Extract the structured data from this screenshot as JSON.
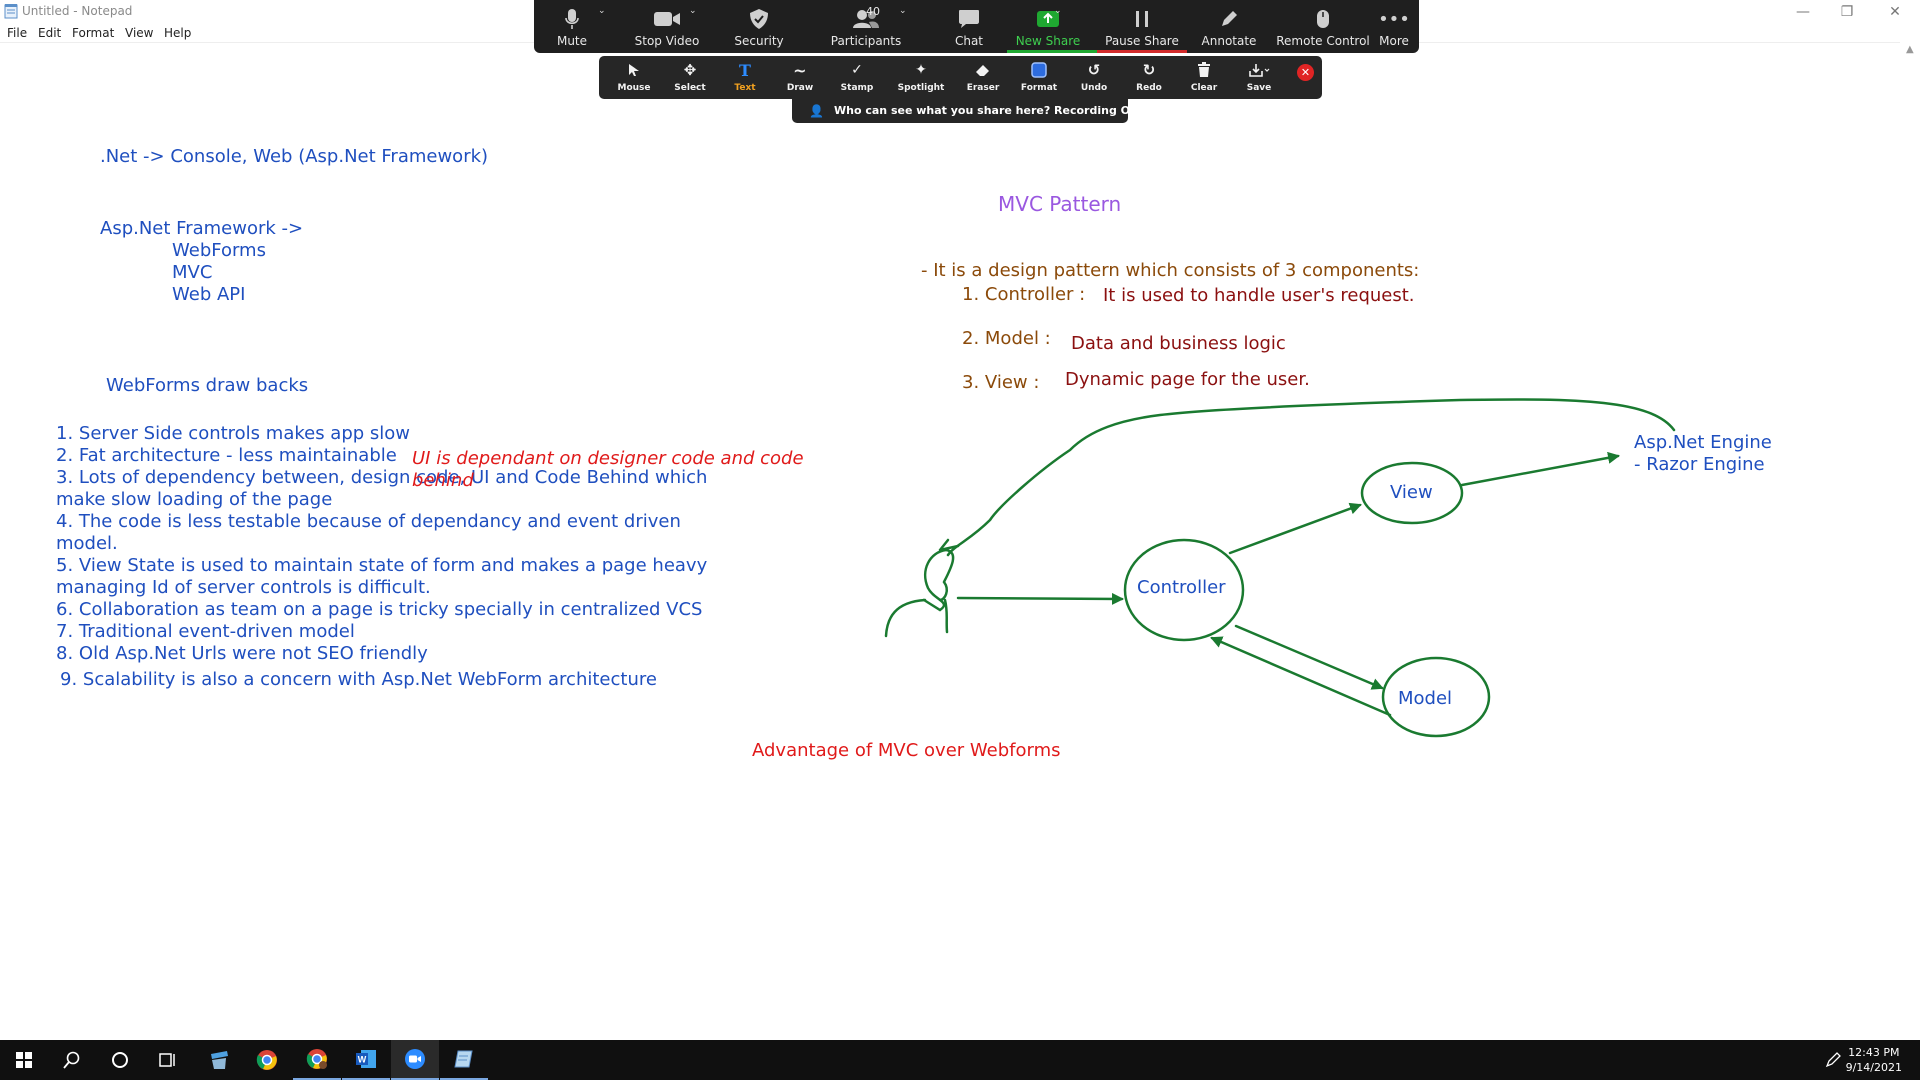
{
  "notepad": {
    "title": "Untitled - Notepad",
    "menu": [
      "File",
      "Edit",
      "Format",
      "View",
      "Help"
    ]
  },
  "zoom_toolbar": {
    "participants_count": "40",
    "buttons": [
      "Mute",
      "Stop Video",
      "Security",
      "Participants",
      "Chat",
      "New Share",
      "Pause Share",
      "Annotate",
      "Remote Control",
      "More"
    ]
  },
  "annotation_toolbar": {
    "tools": [
      "Mouse",
      "Select",
      "Text",
      "Draw",
      "Stamp",
      "Spotlight",
      "Eraser",
      "Format",
      "Undo",
      "Redo",
      "Clear",
      "Save"
    ]
  },
  "share_banner": "Who can see what you share here? Recording On",
  "content": {
    "net_line": ".Net -> Console, Web (Asp.Net Framework)",
    "framework_heading": "Asp.Net Framework ->",
    "framework_items": [
      "WebForms",
      "MVC",
      "Web API"
    ],
    "drawbacks_heading": "WebForms  draw backs",
    "drawbacks": [
      "1. Server Side controls makes app slow",
      "2. Fat architecture - less maintainable",
      "3. Lots of dependency between, design code, UI and Code Behind which",
      "make slow loading of the page",
      "4. The code is less testable because of dependancy and event driven",
      "model.",
      "5. View State is used to maintain state of form and makes a page heavy",
      "managing Id of server controls is difficult.",
      "6. Collaboration as team on a page is tricky specially in centralized VCS",
      "7. Traditional event-driven model",
      "8. Old Asp.Net Urls were not SEO friendly",
      "9. Scalability is also a concern with Asp.Net WebForm architecture"
    ],
    "overlay_note_line1": "UI is dependant on designer code and code",
    "overlay_note_line2": "behind",
    "mvc_title": "MVC Pattern",
    "mvc_intro": "- It is a design pattern which consists of 3 components:",
    "components": [
      {
        "label": "1. Controller :",
        "desc": "It is used to handle user's request."
      },
      {
        "label": "2. Model  :",
        "desc": "Data and business logic"
      },
      {
        "label": "3. View :",
        "desc": "Dynamic page for the user."
      }
    ],
    "advantage": "Advantage of MVC over Webforms"
  },
  "diagram": {
    "nodes": [
      "Controller",
      "View",
      "Model"
    ],
    "engine_line1": "Asp.Net Engine",
    "engine_line2": "- Razor Engine",
    "ink_color": "#1a7a30"
  },
  "taskbar": {
    "time": "12:43 PM",
    "date": "9/14/2021"
  },
  "colors": {
    "blue_text": "#1f4fbf",
    "purple_text": "#9a58e0",
    "brown_text": "#8b4a0a",
    "dark_red_text": "#8b1010",
    "red_text": "#e01a1a",
    "zoom_green": "#1fa831",
    "zoom_bar": "#1f1f1f"
  }
}
